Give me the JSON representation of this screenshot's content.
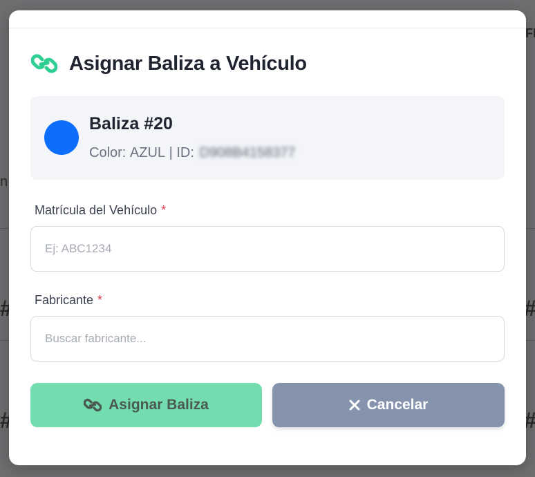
{
  "modal": {
    "title": "Asignar Baliza a Vehículo",
    "header_icon": "link-icon"
  },
  "beacon": {
    "name": "Baliza #20",
    "color_label": "Color:",
    "color_value": "AZUL",
    "separator": "|",
    "id_label": "ID:",
    "id_value": "D908B4158377",
    "dot_color": "#0d6efd"
  },
  "form": {
    "plate": {
      "label": "Matrícula del Vehículo",
      "required_mark": "*",
      "value": "",
      "placeholder": "Ej: ABC1234"
    },
    "manufacturer": {
      "label": "Fabricante",
      "required_mark": "*",
      "value": "",
      "placeholder": "Buscar fabricante..."
    }
  },
  "actions": {
    "assign": {
      "label": "Asignar Baliza",
      "icon": "link-icon",
      "color": "#74ddb0"
    },
    "cancel": {
      "label": "Cancelar",
      "icon": "close-icon",
      "color": "#8593ad"
    }
  },
  "background": {
    "frag_top_right": "FI",
    "frag_left": "n",
    "frag_hash": "#"
  }
}
